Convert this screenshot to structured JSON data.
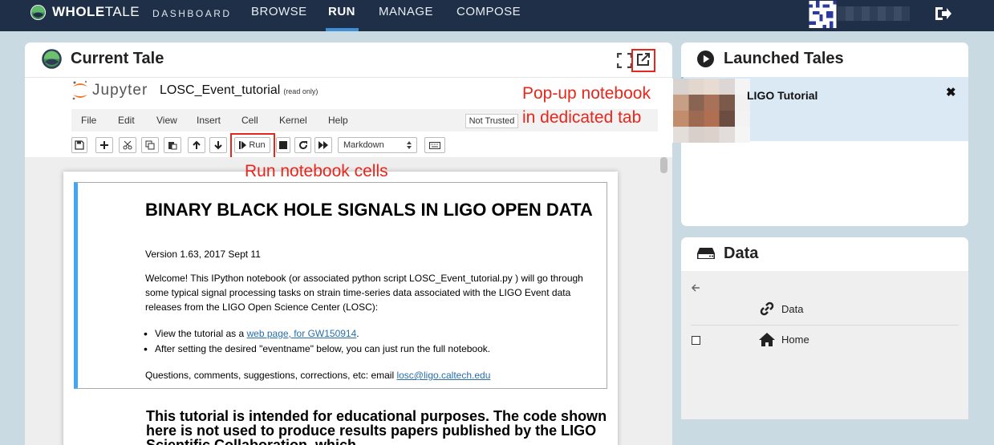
{
  "brand": {
    "name_bold": "WHOLE",
    "name_rest": "TALE",
    "sub": "DASHBOARD"
  },
  "nav": {
    "browse": "BROWSE",
    "run": "RUN",
    "manage": "MANAGE",
    "compose": "COMPOSE"
  },
  "current_tale": {
    "title": "Current Tale"
  },
  "jupyter": {
    "logo_word": "Jupyter",
    "notebook_name": "LOSC_Event_tutorial",
    "read_only": "(read only)",
    "menu": [
      "File",
      "Edit",
      "View",
      "Insert",
      "Cell",
      "Kernel",
      "Help"
    ],
    "trust_badge": "Not Trusted",
    "run_label": "Run",
    "cell_type": "Markdown"
  },
  "notebook": {
    "heading": "BINARY BLACK HOLE SIGNALS IN LIGO OPEN DATA",
    "version": "Version 1.63, 2017 Sept 11",
    "welcome": "Welcome! This IPython notebook (or associated python script LOSC_Event_tutorial.py ) will go through some typical signal processing tasks on strain time-series data associated with the LIGO Event data releases from the LIGO Open Science Center (LOSC):",
    "bullet1_pre": "View the tutorial as a ",
    "bullet1_link": "web page, for GW150914",
    "bullet1_post": ".",
    "bullet2": "After setting the desired \"eventname\" below, you can just run the full notebook.",
    "questions_pre": "Questions, comments, suggestions, corrections, etc: email ",
    "questions_email": "losc@ligo.caltech.edu",
    "heading2": "This tutorial is intended for educational purposes. The code shown here is not used to produce results papers published by the LIGO Scientific Collaboration, which"
  },
  "annotations": {
    "popup_line1": "Pop-up notebook",
    "popup_line2": "in dedicated tab",
    "run_cells": "Run notebook cells"
  },
  "launched_tales": {
    "title": "Launched Tales",
    "items": [
      {
        "name": "LIGO Tutorial"
      }
    ]
  },
  "data_panel": {
    "title": "Data",
    "rows": [
      {
        "label": "Data"
      },
      {
        "label": "Home"
      }
    ]
  },
  "colors": {
    "nav_bg": "#1f2f47",
    "accent": "#3d8fd6",
    "annotation": "#e8261b",
    "cell_bar": "#42a5f5"
  }
}
